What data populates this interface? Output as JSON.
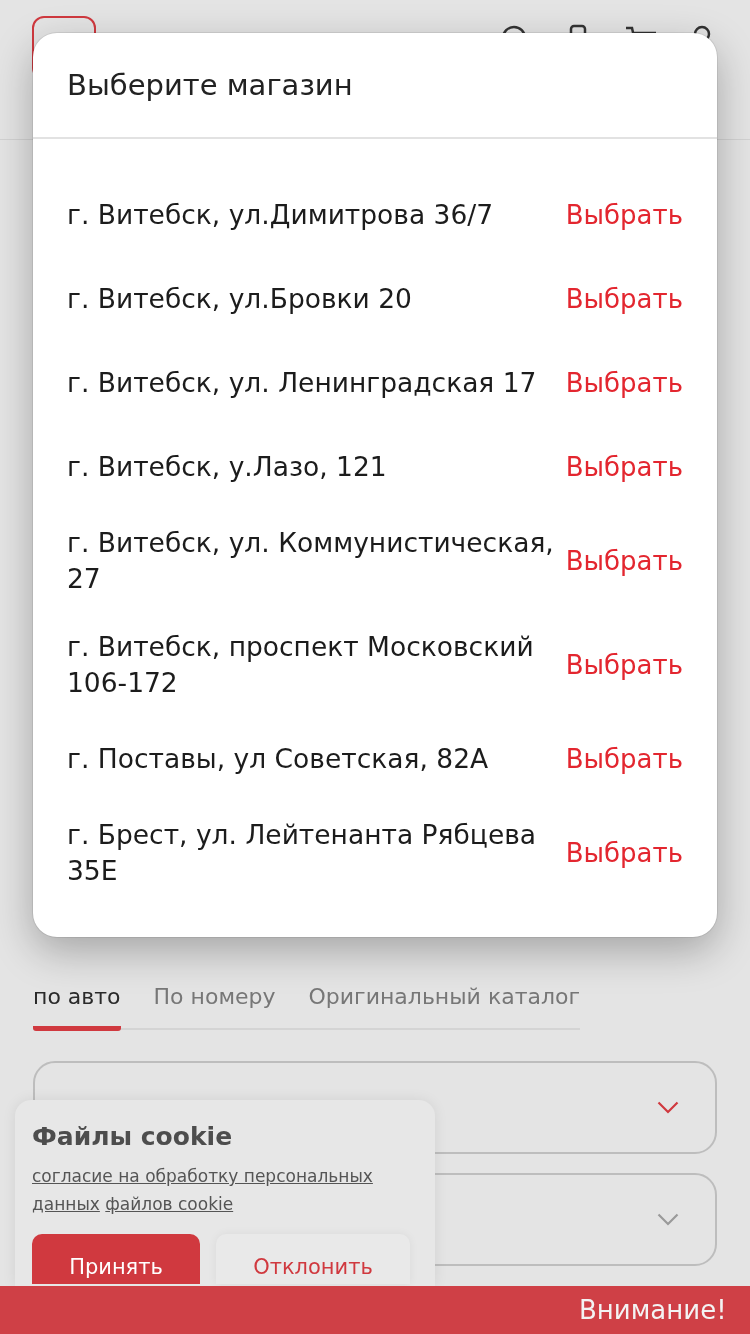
{
  "modal": {
    "title": "Выберите магазин",
    "stores": [
      {
        "address": "г. Витебск, ул.Димитрова 36/7",
        "action": "Выбрать"
      },
      {
        "address": "г. Витебск, ул.Бровки 20",
        "action": "Выбрать"
      },
      {
        "address": "г. Витебск, ул. Ленинградская 17",
        "action": "Выбрать"
      },
      {
        "address": "г. Витебск, у.Лазо, 121",
        "action": "Выбрать"
      },
      {
        "address": "г. Витебск, ул. Коммунистическая, 27",
        "action": "Выбрать"
      },
      {
        "address": "г. Витебск, проспект Московский 106-172",
        "action": "Выбрать"
      },
      {
        "address": "г. Поставы, ул Советская, 82А",
        "action": "Выбрать"
      },
      {
        "address": "г. Брест, ул. Лейтенанта Рябцева 35Е",
        "action": "Выбрать"
      }
    ]
  },
  "search_tabs": [
    {
      "label": "по авто",
      "selected": true
    },
    {
      "label": "По номеру",
      "selected": false
    },
    {
      "label": "Оригинальный каталог",
      "selected": false
    }
  ],
  "selects": [
    {
      "disabled": false
    },
    {
      "disabled": true
    }
  ],
  "cookie_banner": {
    "title": "Файлы cookie",
    "links": [
      "согласие на обработку персональных данных",
      "файлов cookie"
    ],
    "buttons": [
      {
        "label": "Принять",
        "kind": "primary"
      },
      {
        "label": "Отклонить",
        "kind": "secondary"
      }
    ]
  },
  "notice_bar": {
    "text": "Внимание!"
  }
}
